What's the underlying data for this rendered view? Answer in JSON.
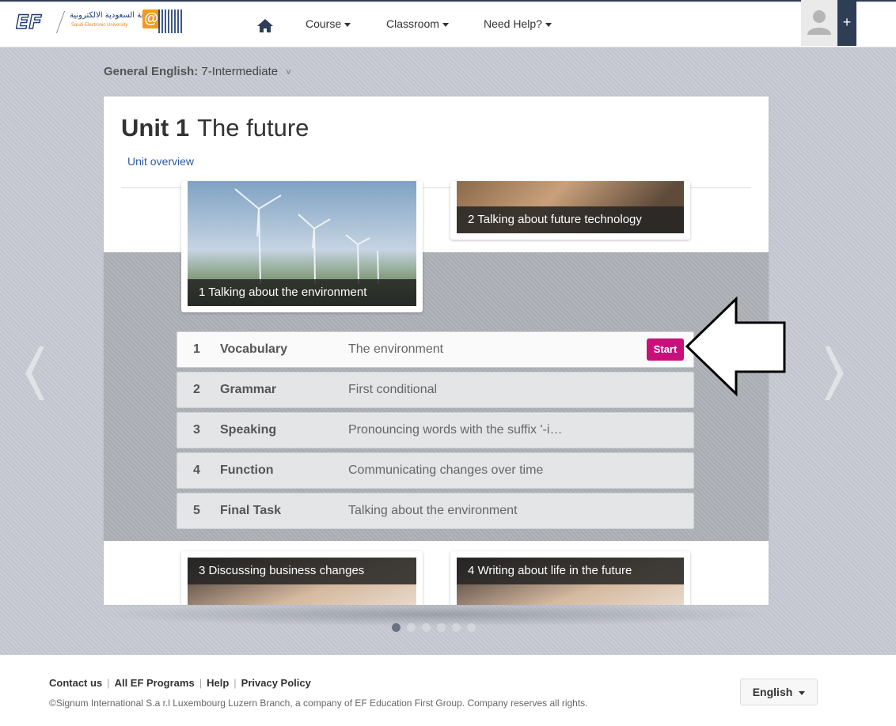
{
  "header": {
    "brand_logo": "EF",
    "university_logo_arabic": "الجامعة السعودية الالكترونية",
    "university_logo_english": "Saudi Electronic University",
    "university_logo_mark": "@",
    "home_icon": "home-icon",
    "nav": [
      {
        "label": "Course"
      },
      {
        "label": "Classroom"
      },
      {
        "label": "Need Help?"
      }
    ],
    "avatar_icon": "user-avatar-icon",
    "plus_label": "+"
  },
  "course_selector": {
    "prefix": "General English:",
    "value": "7-Intermediate",
    "chevron": "˅"
  },
  "unit": {
    "number_label": "Unit 1",
    "name": "The future",
    "overview_link": "Unit overview"
  },
  "lesson_tiles": [
    {
      "caption": "1 Talking about the environment"
    },
    {
      "caption": "2 Talking about future technology"
    },
    {
      "caption": "3 Discussing business changes"
    },
    {
      "caption": "4 Writing about life in the future"
    }
  ],
  "lessons": [
    {
      "num": "1",
      "type": "Vocabulary",
      "title": "The environment",
      "active": true
    },
    {
      "num": "2",
      "type": "Grammar",
      "title": "First conditional",
      "active": false
    },
    {
      "num": "3",
      "type": "Speaking",
      "title": "Pronouncing words with the suffix '-i…",
      "active": false
    },
    {
      "num": "4",
      "type": "Function",
      "title": "Communicating changes over time",
      "active": false
    },
    {
      "num": "5",
      "type": "Final Task",
      "title": "Talking about the environment",
      "active": false
    }
  ],
  "start_label": "Start",
  "carousel": {
    "total_dots": 6,
    "active_index": 0,
    "prev_icon": "chevron-left-icon",
    "next_icon": "chevron-right-icon"
  },
  "footer": {
    "links": [
      "Contact us",
      "All EF Programs",
      "Help",
      "Privacy Policy"
    ],
    "copyright": "©Signum International S.a r.l Luxembourg Luzern Branch, a company of EF Education First Group. Company reserves all rights.",
    "language": "English"
  },
  "colors": {
    "accent_start": "#c8107a",
    "topbar_dark": "#2e3e55",
    "link_blue": "#2c5aa0"
  }
}
